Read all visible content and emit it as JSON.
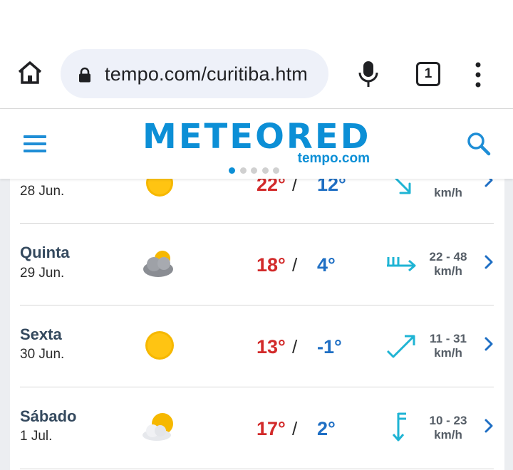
{
  "browser": {
    "url": "tempo.com/curitiba.htm",
    "tab_count": "1"
  },
  "site": {
    "logo_text": "METEORED",
    "logo_sub": "tempo.com",
    "brand_color": "#0c8fd6"
  },
  "forecast": [
    {
      "day": "",
      "date": "28 Jun.",
      "icon": "sun-icon",
      "tmax": "22°",
      "tmin": "12°",
      "wind_range": "",
      "wind_unit": "km/h",
      "wind_icon": "wind-arrow-southeast-icon"
    },
    {
      "day": "Quinta",
      "date": "29 Jun.",
      "icon": "cloudy-sun-icon",
      "tmax": "18°",
      "tmin": "4°",
      "wind_range": "22 - 48",
      "wind_unit": "km/h",
      "wind_icon": "wind-arrow-east-strong-icon"
    },
    {
      "day": "Sexta",
      "date": "30 Jun.",
      "icon": "sun-icon",
      "tmax": "13°",
      "tmin": "-1°",
      "wind_range": "11 - 31",
      "wind_unit": "km/h",
      "wind_icon": "wind-arrow-northeast-icon"
    },
    {
      "day": "Sábado",
      "date": "1 Jul.",
      "icon": "partly-cloudy-icon",
      "tmax": "17°",
      "tmin": "2°",
      "wind_range": "10 - 23",
      "wind_unit": "km/h",
      "wind_icon": "wind-arrow-south-icon"
    }
  ],
  "colors": {
    "max_temp": "#d22a2a",
    "min_temp": "#1f6fc4",
    "wind_icon": "#1fb4d4"
  }
}
